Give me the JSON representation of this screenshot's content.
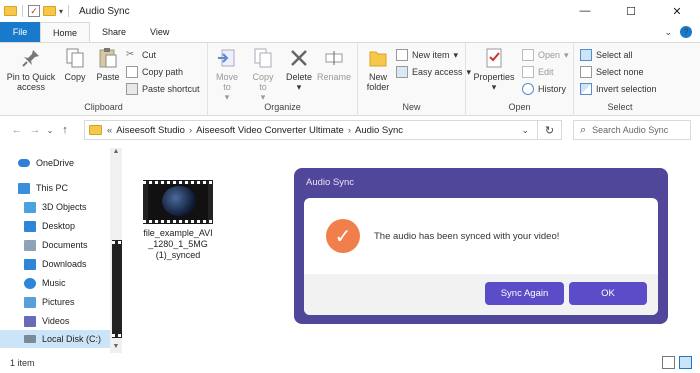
{
  "window": {
    "title": "Audio Sync",
    "minimize_icon": "—",
    "maximize_icon": "☐",
    "close_icon": "✕"
  },
  "tabs": {
    "file": "File",
    "home": "Home",
    "share": "Share",
    "view": "View",
    "collapse_icon": "⌄",
    "help_icon": "?"
  },
  "ribbon": {
    "clipboard": {
      "label": "Clipboard",
      "pin": "Pin to Quick access",
      "copy": "Copy",
      "paste": "Paste",
      "cut": "Cut",
      "copy_path": "Copy path",
      "paste_shortcut": "Paste shortcut"
    },
    "organize": {
      "label": "Organize",
      "move_to": "Move to",
      "copy_to": "Copy to",
      "delete": "Delete",
      "rename": "Rename"
    },
    "new": {
      "label": "New",
      "new_folder": "New folder",
      "new_item": "New item",
      "easy_access": "Easy access"
    },
    "open": {
      "label": "Open",
      "properties": "Properties",
      "open": "Open",
      "edit": "Edit",
      "history": "History"
    },
    "select": {
      "label": "Select",
      "select_all": "Select all",
      "select_none": "Select none",
      "invert": "Invert selection"
    }
  },
  "address": {
    "back": "←",
    "forward": "→",
    "recent": "⌄",
    "up": "↑",
    "overflow": "«",
    "crumbs": [
      "Aiseesoft Studio",
      "Aiseesoft Video Converter Ultimate",
      "Audio Sync"
    ],
    "separator": "›",
    "dropdown": "⌄",
    "refresh": "↻",
    "search_placeholder": "Search Audio Sync",
    "search_icon": "⌕"
  },
  "nav": {
    "items": [
      {
        "label": "OneDrive",
        "icon": "cloud-icon",
        "color": "#2f7fd6"
      },
      {
        "label": "This PC",
        "icon": "computer-icon",
        "color": "#3a8edb"
      },
      {
        "label": "3D Objects",
        "icon": "cube-icon",
        "color": "#4aa3e0"
      },
      {
        "label": "Desktop",
        "icon": "desktop-icon",
        "color": "#2f86d8"
      },
      {
        "label": "Documents",
        "icon": "documents-icon",
        "color": "#8ea2b8"
      },
      {
        "label": "Downloads",
        "icon": "downloads-icon",
        "color": "#2f86d8"
      },
      {
        "label": "Music",
        "icon": "music-icon",
        "color": "#2f86d8"
      },
      {
        "label": "Pictures",
        "icon": "pictures-icon",
        "color": "#5aa0d8"
      },
      {
        "label": "Videos",
        "icon": "videos-icon",
        "color": "#6a6ab8"
      },
      {
        "label": "Local Disk (C:)",
        "icon": "disk-icon",
        "color": "#7a8a99"
      }
    ],
    "scroll_up": "▲",
    "scroll_down": "▼"
  },
  "files": [
    {
      "name": "file_example_AVI_1280_1_5MG (1)_synced",
      "lines": [
        "file_example_AVI",
        "_1280_1_5MG",
        "(1)_synced"
      ]
    }
  ],
  "dialog": {
    "title": "Audio Sync",
    "message": "The audio has been synced with your video!",
    "check_icon": "✓",
    "sync_again": "Sync Again",
    "ok": "OK"
  },
  "status": {
    "count": "1 item"
  },
  "colors": {
    "accent": "#1979ca",
    "dialog_frame": "#51479a",
    "dialog_button": "#5b4cc8",
    "success": "#f07f4b"
  }
}
